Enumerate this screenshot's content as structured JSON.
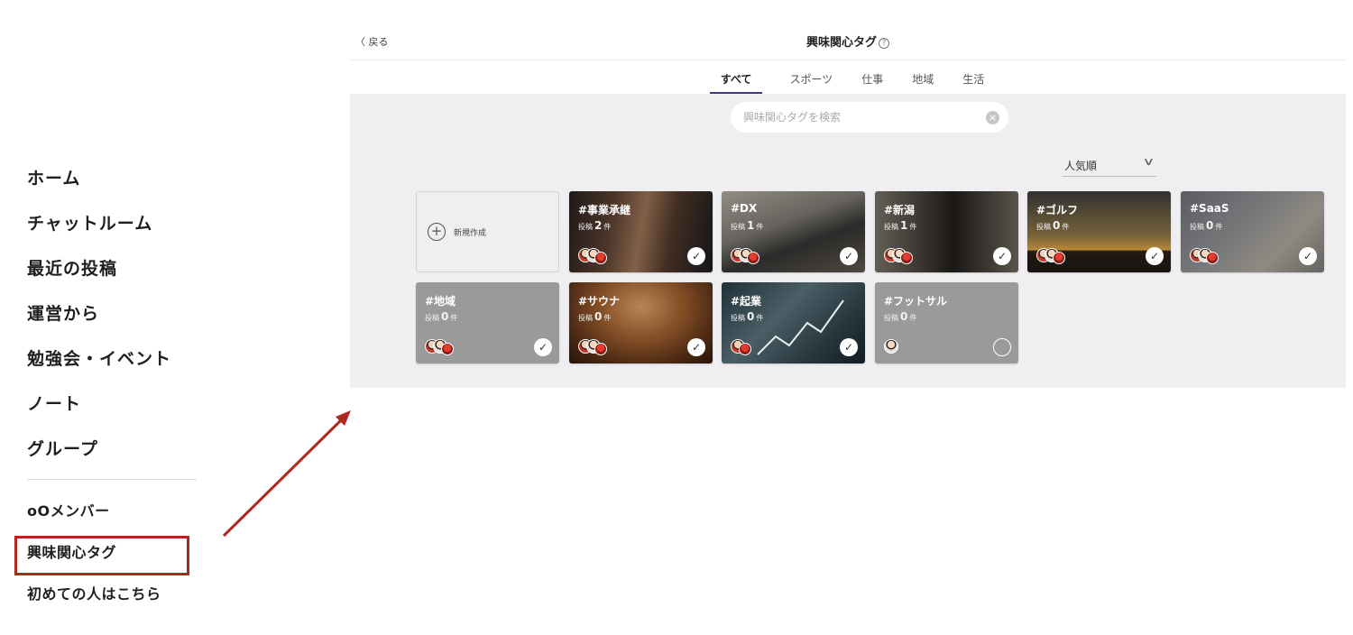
{
  "sidebar": {
    "main_items": [
      {
        "label": "ホーム"
      },
      {
        "label": "チャットルーム"
      },
      {
        "label": "最近の投稿"
      },
      {
        "label": "運営から"
      },
      {
        "label": "勉強会・イベント"
      },
      {
        "label": "ノート"
      },
      {
        "label": "グループ"
      }
    ],
    "sub_items": [
      {
        "label": "oOメンバー"
      },
      {
        "label": "興味関心タグ"
      },
      {
        "label": "初めての人はこちら"
      }
    ],
    "highlight_color": "#b0271f"
  },
  "header": {
    "back_label": "〈 戻る",
    "title": "興味関心タグ",
    "help_icon": "?"
  },
  "tabs": [
    {
      "label": "すべて",
      "active": true
    },
    {
      "label": "スポーツ"
    },
    {
      "label": "仕事"
    },
    {
      "label": "地域"
    },
    {
      "label": "生活"
    }
  ],
  "search": {
    "placeholder": "興味関心タグを検索",
    "clear_icon": "×"
  },
  "sort": {
    "selected": "人気順"
  },
  "new_card": {
    "label": "新規作成",
    "icon": "+"
  },
  "count_prefix": "投稿",
  "count_suffix": "件",
  "tags": [
    {
      "name": "#事業承継",
      "count": "2",
      "selected": true
    },
    {
      "name": "#DX",
      "count": "1",
      "selected": true
    },
    {
      "name": "#新潟",
      "count": "1",
      "selected": true
    },
    {
      "name": "#ゴルフ",
      "count": "0",
      "selected": true
    },
    {
      "name": "#SaaS",
      "count": "0",
      "selected": true
    },
    {
      "name": "#地域",
      "count": "0",
      "selected": true
    },
    {
      "name": "#サウナ",
      "count": "0",
      "selected": true
    },
    {
      "name": "#起業",
      "count": "0",
      "selected": true
    },
    {
      "name": "#フットサル",
      "count": "0",
      "selected": false
    }
  ],
  "check_mark": "✓",
  "colors": {
    "accent": "#3d3a7a",
    "panel_bg": "#efeff2"
  }
}
